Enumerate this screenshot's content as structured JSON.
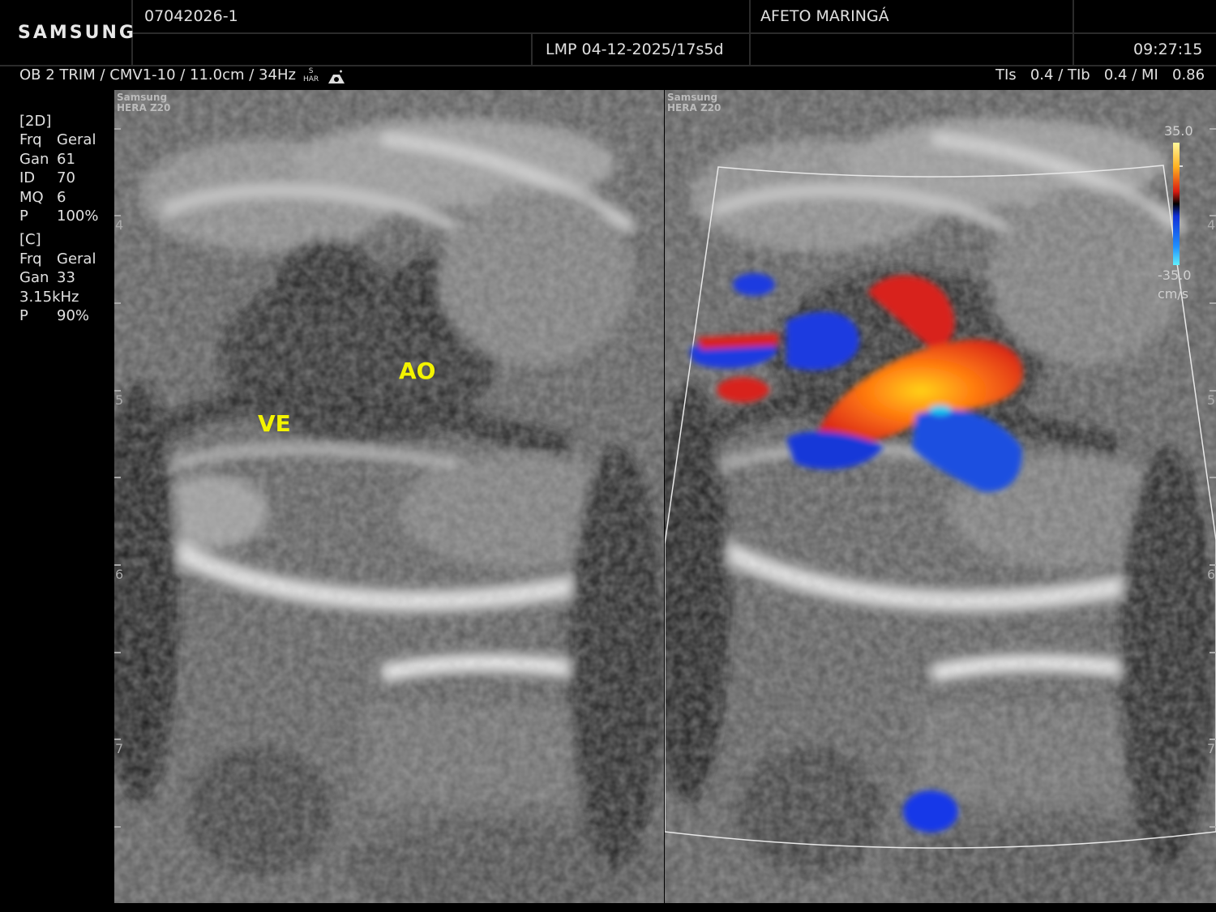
{
  "brand": {
    "logo": "SAMSUNG"
  },
  "header": {
    "patient_id": "07042026-1",
    "institution": "AFETO MARINGÁ",
    "lmp": "LMP 04-12-2025/17s5d",
    "time": "09:27:15"
  },
  "info_bar": {
    "preset": "OB 2 TRIM / CMV1-10 / 11.0cm / 34Hz",
    "har_s": "S",
    "har": "HAR",
    "indices": "TIs   0.4 / TIb   0.4 / MI   0.86"
  },
  "params": {
    "mode_2d": "[2D]",
    "rows_2d": [
      {
        "k": "Frq",
        "v": "Geral"
      },
      {
        "k": "Gan",
        "v": "61"
      },
      {
        "k": "ID",
        "v": "70"
      },
      {
        "k": "MQ",
        "v": "6"
      },
      {
        "k": "P",
        "v": "100%"
      }
    ],
    "mode_c": "[C]",
    "rows_c": [
      {
        "k": "Frq",
        "v": "Geral"
      },
      {
        "k": "Gan",
        "v": "33"
      },
      {
        "k": "3.15kHz",
        "v": ""
      },
      {
        "k": "P",
        "v": "90%"
      }
    ]
  },
  "watermark": {
    "line1": "Samsung",
    "line2": "HERA Z20"
  },
  "depth_marks": [
    "4",
    "5",
    "6",
    "7"
  ],
  "labels": {
    "ve": "VE",
    "ao": "AO"
  },
  "color_scale": {
    "top": "35.0",
    "bottom": "-35.0",
    "unit": "cm/s"
  },
  "colors": {
    "label_yellow": "#f3f300",
    "flow_red": "#d8231a",
    "flow_blue": "#1438d8"
  }
}
